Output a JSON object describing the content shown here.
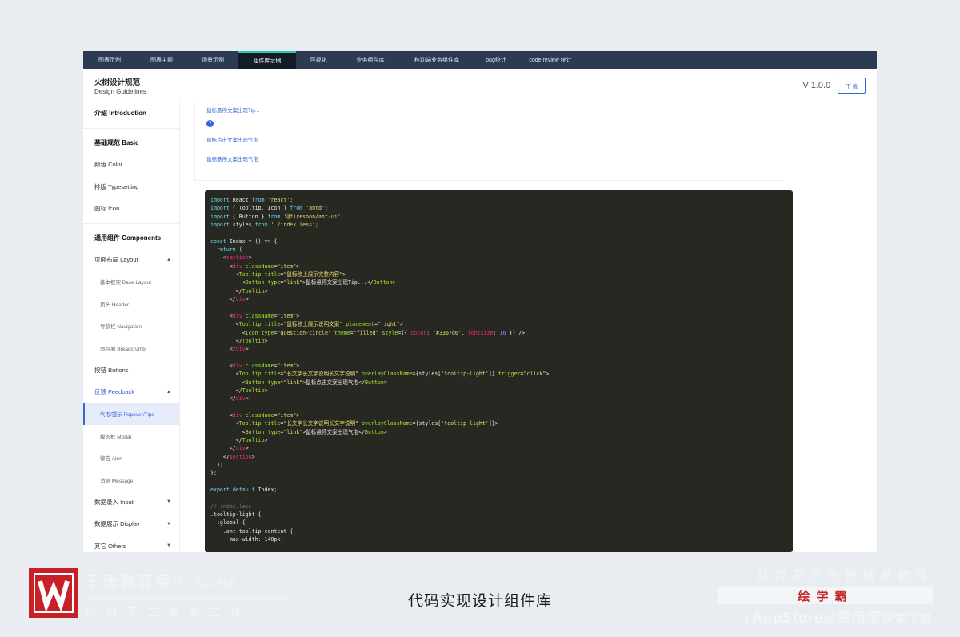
{
  "topnav": {
    "tabs": [
      {
        "label": "图表示例"
      },
      {
        "label": "图表主题"
      },
      {
        "label": "场景示例"
      },
      {
        "label": "组件库示例",
        "active": true
      },
      {
        "label": "可视化"
      },
      {
        "label": "业务组件库"
      },
      {
        "label": "移动端业务组件库"
      },
      {
        "label": "bug统计"
      },
      {
        "label": "code review 统计"
      }
    ]
  },
  "header": {
    "title_cn": "火树设计规范",
    "title_en": "Design Guidelines",
    "version": "V 1.0.0",
    "download_label": "下 载"
  },
  "sidebar": {
    "intro": "介绍 Introduction",
    "basic_group": "基础规范 Basic",
    "basic_items": [
      "颜色 Color",
      "排版 Typesetting",
      "图标 Icon"
    ],
    "components_group": "通用组件 Components",
    "layout": "页面布局 Layout",
    "layout_items": [
      "基本框架 Base Layout",
      "页头 Header",
      "导航栏 Navigation",
      "面包屑 Breadcrumb"
    ],
    "buttons": "按钮 Buttons",
    "feedback": "反馈 Feedback",
    "feedback_items": [
      "气泡/提示 Popover/Tips",
      "模态框 Modal",
      "警告 Alert",
      "消息 Message"
    ],
    "input": "数据录入 Input",
    "display": "数据展示 Display",
    "others": "其它 Others"
  },
  "demo": {
    "link1": "鼠标悬停文案出现Tip...",
    "link2": "鼠标点击文案出现气泡",
    "link3": "鼠标悬停文案出现气泡"
  },
  "code_lines": [
    "import React from 'react';",
    "import { Tooltip, Icon } from 'antd';",
    "import { Button } from '@firesoon/ant-ui';",
    "import styles from './index.less';",
    "",
    "const Index = () => {",
    "  return (",
    "    <section>",
    "      <div className=\"item\">",
    "        <Tooltip title=\"鼠标移上展示完整内容\">",
    "          <Button type=\"link\">鼠标悬停文案出现Tip...</Button>",
    "        </Tooltip>",
    "      </div>",
    "",
    "      <div className=\"item\">",
    "        <Tooltip title=\"鼠标移上展示说明文案\" placement=\"right\">",
    "          <Icon type=\"question-circle\" theme=\"filled\" style={{ color: '#3367d6', fontSize: 16 }} />",
    "        </Tooltip>",
    "      </div>",
    "",
    "      <div className=\"item\">",
    "        <Tooltip title=\"长文字长文字说明长文字说明\" overlayClassName={styles['tooltip-light']} trigger=\"click\">",
    "          <Button type=\"link\">鼠标点击文案出现气泡</Button>",
    "        </Tooltip>",
    "      </div>",
    "",
    "      <div className=\"item\">",
    "        <Tooltip title=\"长文字长文字说明长文字说明\" overlayClassName={styles['tooltip-light']}>",
    "          <Button type=\"link\">鼠标悬停文案出现气泡</Button>",
    "        </Tooltip>",
    "      </div>",
    "    </section>",
    "  );",
    "};",
    "",
    "export default Index;",
    "",
    "// index.less",
    ".tooltip-light {",
    "  :global {",
    "    .ant-tooltip-content {",
    "      max-width: 140px;"
  ],
  "footer": {
    "company": "王氏教育集团",
    "slogan": "以人为本",
    "founded": "始创于二零零二年",
    "caption": "代码实现设计组件库",
    "promo_top": "获得更多免费精品教程",
    "brand": "绘学霸",
    "promo_pre": "在",
    "promo_appstore": "AppStore",
    "promo_or": "或",
    "promo_yyb": "应用宝",
    "promo_post": "搜索下载"
  },
  "colors": {
    "nav_bg": "#2c3b51",
    "accent": "#3367d6",
    "code_bg": "#272822",
    "brand_red": "#c72127"
  }
}
